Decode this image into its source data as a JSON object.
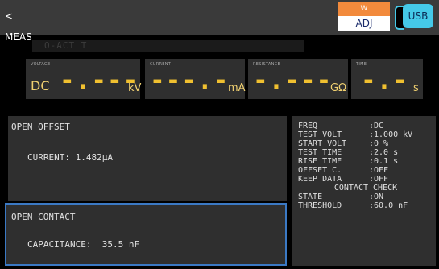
{
  "top_bar": {
    "back_label": "< MEAS",
    "adj": {
      "label": "ADJ",
      "top_glyph": "W"
    },
    "usb_label": "USB"
  },
  "title_strip": {
    "text": "O-ACT T"
  },
  "measurements": {
    "dc_label": "DC",
    "voltage": {
      "label": "VOLTAGE",
      "value": "-.---",
      "unit": "kV"
    },
    "current": {
      "label": "CURRENT",
      "value": "---.-",
      "unit": "mA"
    },
    "resistance": {
      "label": "RESISTANCE",
      "value": "-.---",
      "unit": "GΩ"
    },
    "time": {
      "label": "TIME",
      "value": "-.-",
      "unit": "s"
    }
  },
  "open_offset": {
    "title": "OPEN OFFSET",
    "current_text": "CURRENT: 1.482μA"
  },
  "open_contact": {
    "title": "OPEN CONTACT",
    "capacitance_text": "CAPACITANCE:  35.5 nF"
  },
  "settings": {
    "rows": [
      {
        "key": "FREQ",
        "value": ":DC"
      },
      {
        "key": "TEST VOLT",
        "value": ":1.000 kV"
      },
      {
        "key": "START VOLT",
        "value": ":0 %"
      },
      {
        "key": "TEST TIME",
        "value": ":2.0 s"
      },
      {
        "key": "RISE TIME",
        "value": ":0.1 s"
      },
      {
        "key": "OFFSET C.",
        "value": ":OFF"
      },
      {
        "key": "KEEP DATA",
        "value": ":OFF"
      }
    ],
    "contact_check_header": "CONTACT CHECK",
    "contact_rows": [
      {
        "key": "STATE",
        "value": ":ON"
      },
      {
        "key": "THRESHOLD",
        "value": ":60.0 nF"
      }
    ]
  },
  "colors": {
    "background": "#000000",
    "panel": "#2f2f2f",
    "accent_orange": "#f28a3c",
    "usb_cyan": "#45c9e8",
    "highlight_border": "#3b79c4",
    "readout_yellow": "#f0c030"
  }
}
